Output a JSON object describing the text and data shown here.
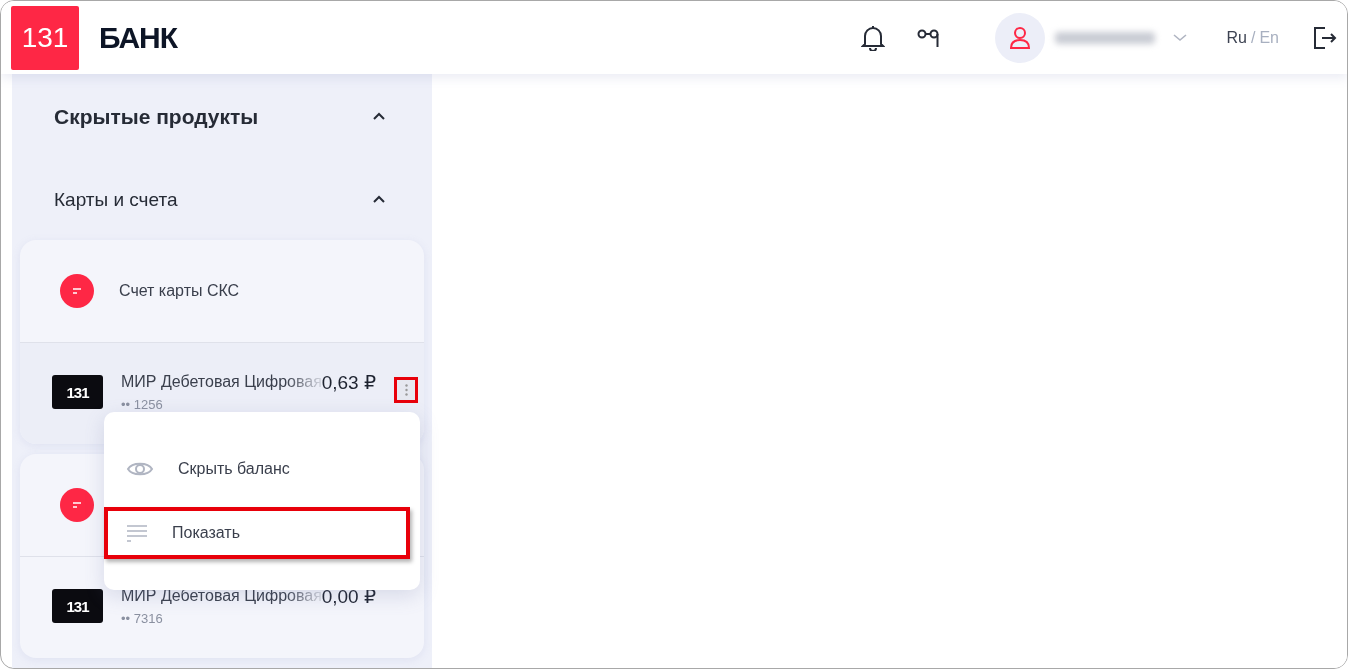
{
  "header": {
    "logo_mark": "131",
    "logo_text": "БАНК",
    "languages": [
      {
        "label": "Ru",
        "selected": true
      },
      {
        "label": "En",
        "selected": false
      }
    ],
    "language_separator": "/"
  },
  "sidebar": {
    "sections": [
      {
        "title": "Скрытые продукты",
        "expanded": true,
        "bold": true
      },
      {
        "title": "Карты и счета",
        "expanded": true,
        "bold": false
      }
    ],
    "groups": [
      {
        "account": "Счет карты СКС",
        "card": {
          "name": "МИР Дебетовая Цифровая",
          "mark": "131",
          "number": "•• 1256",
          "balance": "0,63 ₽",
          "menu_open": true
        }
      },
      {
        "card": {
          "name": "МИР Дебетовая Цифровая",
          "mark": "131",
          "number": "•• 7316",
          "balance": "0,00 ₽",
          "menu_open": false
        }
      }
    ]
  },
  "menu": {
    "items": [
      {
        "kind": "eye",
        "label": "Скрыть баланс",
        "highlighted": false
      },
      {
        "kind": "list",
        "label": "Показать",
        "highlighted": true
      }
    ]
  }
}
